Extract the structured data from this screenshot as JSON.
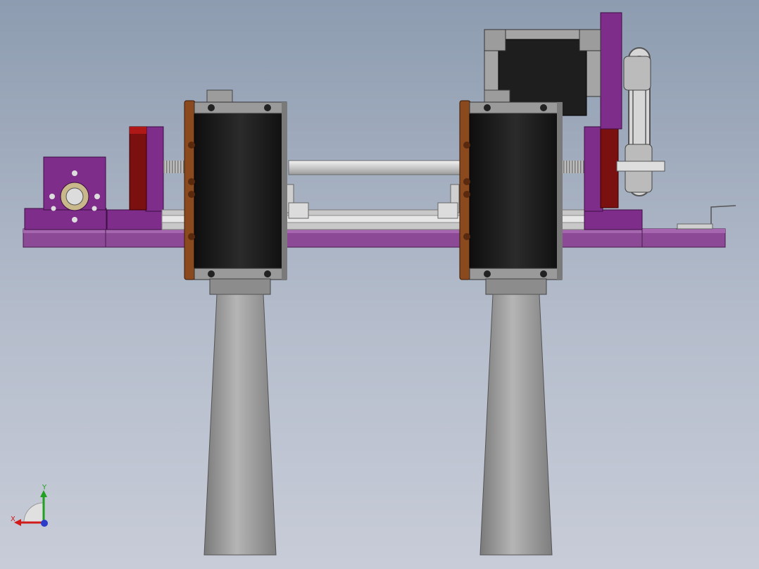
{
  "viewport": {
    "background_top": "#8d9cb0",
    "background_bottom": "#c8ccd8"
  },
  "colors": {
    "frame_purple": "#7e2d8a",
    "frame_purple_light": "#9a4fa3",
    "base_rail_purple": "#8c4a96",
    "motor_black": "#1e1e1e",
    "motor_flange_gray": "#a5a5a5",
    "copper_plate": "#8a4a1e",
    "dark_red_block": "#7a1010",
    "column_gray": "#9a9a9a",
    "shaft_silver": "#d8d8d8"
  },
  "triad": {
    "x_label": "X",
    "y_label": "Y",
    "x_color": "#d11a1a",
    "y_color": "#22a022",
    "z_color": "#2a3cc8"
  }
}
